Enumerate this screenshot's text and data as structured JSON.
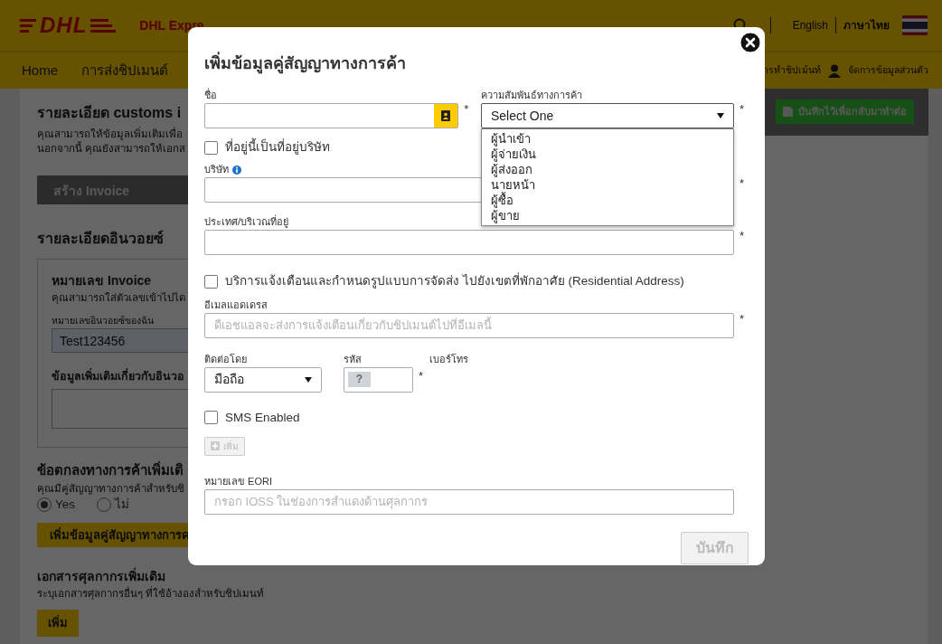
{
  "header": {
    "logo_text": "DHL",
    "brand": "DHL Expre",
    "languages": [
      {
        "label": "English",
        "selected": false
      },
      {
        "label": "ภาษาไทย",
        "selected": true
      }
    ]
  },
  "nav": {
    "items": [
      {
        "label": "Home"
      },
      {
        "label": "การส่งชิปเมนต์"
      }
    ],
    "right_items": [
      {
        "label": "ารทำชิปเม้นท์",
        "kind": "link"
      },
      {
        "label": "จัดการข้อมูลส่วนตัว",
        "kind": "profile"
      }
    ]
  },
  "save_later": {
    "label": "บันทึกไว้เพื่อกลับมาทำต่อ"
  },
  "page": {
    "title": "รายละเอียด customs i",
    "intro": [
      "คุณสามารถให้ข้อมูลเพิ่มเติมเพื่อ",
      "นอกจากนี้ คุณยังสามารถให้เอกส"
    ],
    "create_invoice": "สร้าง Invoice",
    "invoice_heading": "รายละเอียดอินวอยซ์",
    "invoice_box": {
      "title": "หมายเลข Invoice",
      "hint": "คุณสามารถใส่ตัวเลขเข้าไปได",
      "number_label": "หมายเลขอินวอยซ์ของฉัน",
      "number_value": "Test123456",
      "extra_label": "ข้อมูลเพิ่มเติมเกี่ยวกับอินวอ"
    },
    "agreement": {
      "title": "ข้อตกลงทางการค้าเพิ่มเติ",
      "question": "คุณมีคู่สัญญาทางการค้าสำหรับชิ",
      "options": [
        {
          "label": "Yes",
          "selected": true
        },
        {
          "label": "ไม่",
          "selected": false
        }
      ],
      "button": "เพิ่มข้อมูลคู่สัญญาทางการค"
    },
    "documents": {
      "title": "เอกสารศุลกากรเพิ่มเติม",
      "hint": "ระบุเอกสารศุลกากรอื่นๆ ที่ใช้อ้างองสำหรับชิปเมนท์",
      "button": "เพิ่ม"
    }
  },
  "modal": {
    "title": "เพิ่มข้อมูลคู่สัญญาทางการค้า",
    "name": {
      "label": "ชื่อ",
      "required_mark": "*"
    },
    "relationship": {
      "label": "ความสัมพันธ์ทางการค้า",
      "value": "Select One",
      "required_mark": "*",
      "expanded": true,
      "options": [
        {
          "label": "ผู้นำเข้า"
        },
        {
          "label": "ผู้จ่ายเงิน"
        },
        {
          "label": "ผู้ส่งออก"
        },
        {
          "label": "นายหน้า"
        },
        {
          "label": "ผู้ซื้อ"
        },
        {
          "label": "ผู้ขาย"
        }
      ]
    },
    "company_address": {
      "label": "ที่อยู่นี้เป็นที่อยู่บริษัท",
      "checked": false
    },
    "company": {
      "label": "บริษัท",
      "required_mark": "*"
    },
    "country": {
      "label": "ประเทศ/บริเวณที่อยู่",
      "required_mark": "*"
    },
    "residential": {
      "label": "บริการแจ้งเตือนและกำหนดรูปแบบการจัดส่ง ไปยังเขตที่พักอาศัย (Residential Address)",
      "checked": false
    },
    "email": {
      "label": "อีเมลแอดเดรส",
      "placeholder": "ดีเอชแอลจะส่งการแจ้งเตือนเกี่ยวกับชิปเมนต์ไปที่อีเมลนี้",
      "required_mark": "*"
    },
    "contact_by": {
      "label": "ติดต่อโดย",
      "value": "มือถือ"
    },
    "code": {
      "label": "รหัส",
      "flag": "?",
      "required_mark": "*"
    },
    "phone": {
      "label": "เบอร์โทร"
    },
    "sms": {
      "label": "SMS Enabled",
      "checked": false
    },
    "add_button": {
      "label": "เพิ่ม",
      "disabled": true
    },
    "eori": {
      "label": "หมายเลข EORI",
      "placeholder": "กรอก IOSS ในช่องการสำแดงด้านศุลกากร"
    },
    "save_button": {
      "label": "บันทึก",
      "disabled": true
    }
  }
}
